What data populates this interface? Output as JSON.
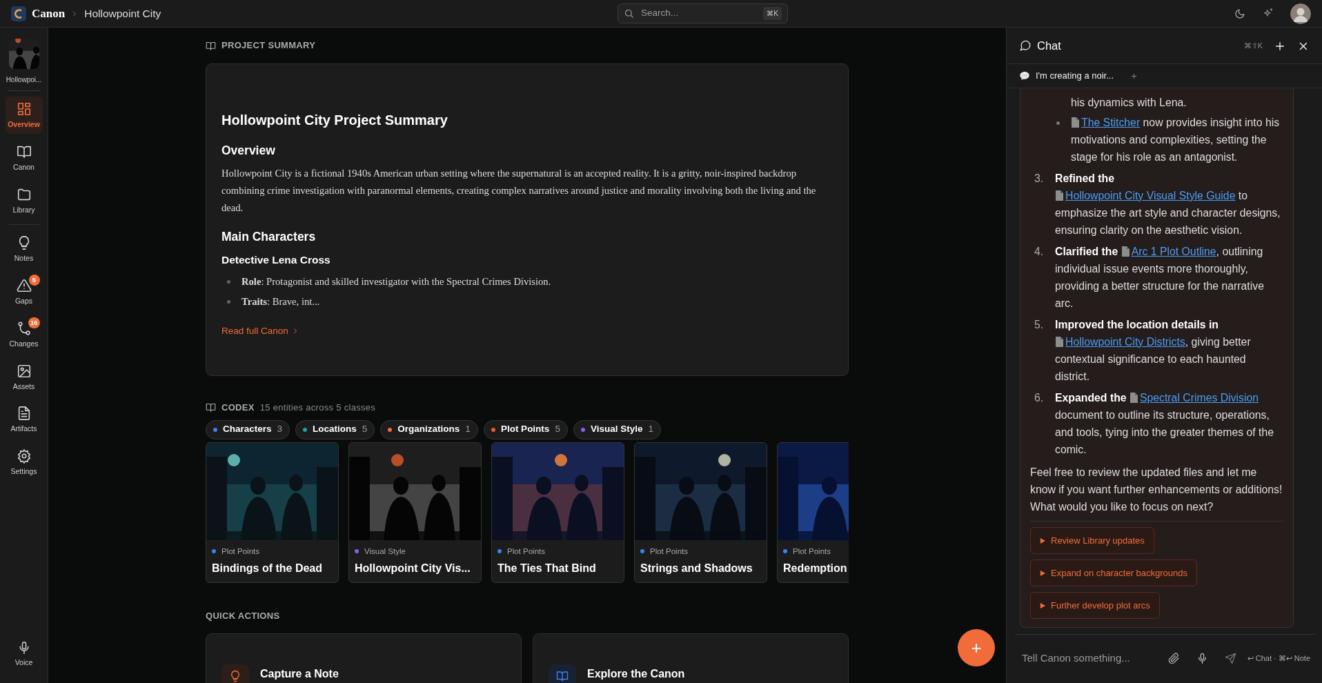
{
  "topbar": {
    "brand": "Canon",
    "breadcrumb": "Hollowpoint City",
    "search": {
      "placeholder": "Search...",
      "shortcut": "⌘K"
    }
  },
  "sidebar": {
    "project": {
      "label": "Hollowpoi..."
    },
    "nav_groups": [
      [
        {
          "label": "Overview",
          "selected": true
        },
        {
          "label": "Canon",
          "selected": false
        },
        {
          "label": "Library",
          "selected": false
        }
      ],
      [
        {
          "label": "Notes",
          "selected": false
        },
        {
          "label": "Gaps",
          "selected": false,
          "badge": "5"
        },
        {
          "label": "Changes",
          "selected": false,
          "badge": "16"
        },
        {
          "label": "Assets",
          "selected": false
        },
        {
          "label": "Artifacts",
          "selected": false
        },
        {
          "label": "Settings",
          "selected": false
        }
      ]
    ],
    "footer": {
      "label": "Voice"
    }
  },
  "summary": {
    "heading": "PROJECT SUMMARY",
    "title": "Hollowpoint City Project Summary",
    "blocks": [
      {
        "kind": "h3",
        "text": "Overview"
      },
      {
        "kind": "p",
        "text": "Hollowpoint City is a fictional 1940s American urban setting where the supernatural is an accepted reality. It is a gritty, noir-inspired backdrop combining crime investigation with paranormal elements, creating complex narratives around justice and morality involving both the living and the dead."
      },
      {
        "kind": "h3",
        "text": "Main Characters"
      },
      {
        "kind": "h4",
        "text": "Detective Lena Cross"
      },
      {
        "kind": "ul",
        "items": [
          "**Role**: Protagonist and skilled investigator with the Spectral Crimes Division.",
          "**Traits**: Brave, int..."
        ]
      }
    ],
    "link": "Read full Canon"
  },
  "codex": {
    "heading": "CODEX",
    "subtitle": "15 entities across 5 classes",
    "filters": [
      {
        "label": "Characters",
        "count": "3",
        "color": "#3b82f6"
      },
      {
        "label": "Locations",
        "count": "5",
        "color": "#2a9d9a"
      },
      {
        "label": "Organizations",
        "count": "1",
        "color": "#f26b3a"
      },
      {
        "label": "Plot Points",
        "count": "5",
        "color": "#f0582c"
      },
      {
        "label": "Visual Style",
        "count": "1",
        "color": "#8b5cf6"
      }
    ],
    "cards": [
      {
        "category": "Plot Points",
        "color": "#3b82f6",
        "title": "Bindings of the Dead"
      },
      {
        "category": "Visual Style",
        "color": "#8b5cf6",
        "title": "Hollowpoint City Vis..."
      },
      {
        "category": "Plot Points",
        "color": "#3b82f6",
        "title": "The Ties That Bind"
      },
      {
        "category": "Plot Points",
        "color": "#3b82f6",
        "title": "Strings and Shadows"
      },
      {
        "category": "Plot Points",
        "color": "#3b82f6",
        "title": "Redemption"
      }
    ]
  },
  "quick_actions": {
    "heading": "QUICK ACTIONS",
    "items": [
      {
        "title": "Capture a Note"
      },
      {
        "title": "Explore the Canon"
      }
    ]
  },
  "fab": {
    "label": "+"
  },
  "chat": {
    "title": "Chat",
    "shortcut": "⌘⇧K",
    "tabs": [
      {
        "label": "I'm creating a noir...",
        "selected": true
      }
    ],
    "message": {
      "sub_items": [
        {
          "bullet": false,
          "text": "his dynamics with Lena."
        },
        {
          "bullet": true,
          "link": "The Stitcher",
          "text": " now provides insight into his motivations and complexities, setting the stage for his role as an antagonist."
        }
      ],
      "steps": [
        {
          "number": "3.",
          "lead": "Refined the",
          "link": "Hollowpoint City Visual Style Guide",
          "text": " to emphasize the art style and character designs, ensuring clarity on the aesthetic vision."
        },
        {
          "number": "4.",
          "lead": "Clarified the",
          "link": "Arc 1 Plot Outline",
          "text": ", outlining individual issue events more thoroughly, providing a better structure for the narrative arc."
        },
        {
          "number": "5.",
          "lead": "Improved the location details in",
          "link": "Hollowpoint City Districts",
          "text": ", giving better contextual significance to each haunted district."
        },
        {
          "number": "6.",
          "lead": "Expanded the",
          "link": "Spectral Crimes Division",
          "text": " document to outline its structure, operations, and tools, tying into the greater themes of the comic."
        }
      ],
      "closing": "Feel free to review the updated files and let me know if you want further enhancements or additions! What would you like to focus on next?",
      "suggestions": [
        "Review Library updates",
        "Expand on character backgrounds",
        "Further develop plot arcs"
      ]
    },
    "input": {
      "placeholder": "Tell Canon something...",
      "hint": "↩ Chat · ⌘↩ Note"
    }
  }
}
